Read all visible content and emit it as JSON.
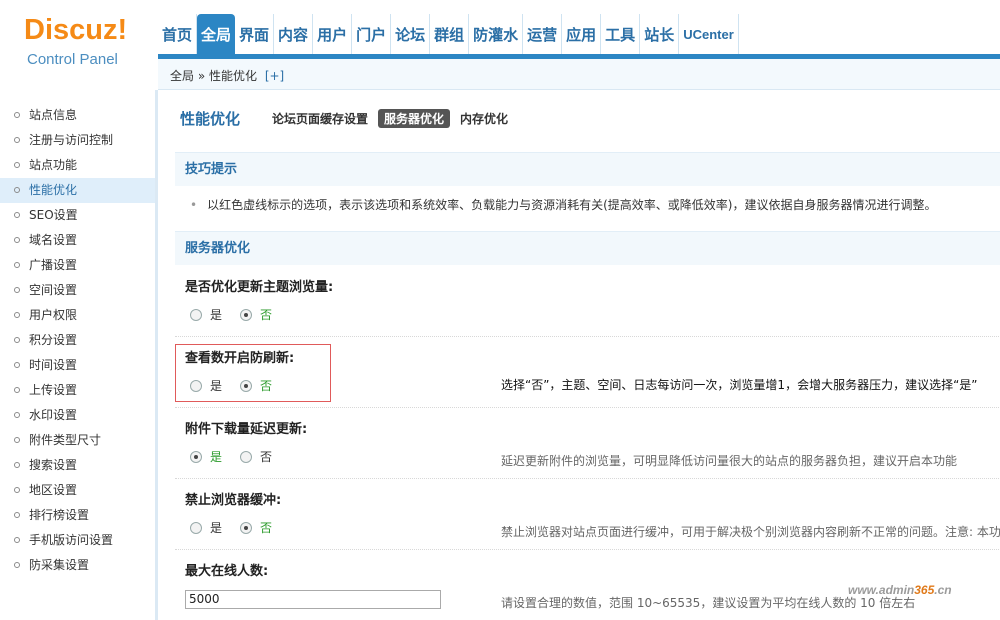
{
  "logo": {
    "main": "Discuz!",
    "sub": "Control Panel"
  },
  "topnav": {
    "tabs": [
      {
        "label": "首页",
        "active": false
      },
      {
        "label": "全局",
        "active": true
      },
      {
        "label": "界面",
        "active": false
      },
      {
        "label": "内容",
        "active": false
      },
      {
        "label": "用户",
        "active": false
      },
      {
        "label": "门户",
        "active": false
      },
      {
        "label": "论坛",
        "active": false
      },
      {
        "label": "群组",
        "active": false
      },
      {
        "label": "防灌水",
        "active": false
      },
      {
        "label": "运营",
        "active": false
      },
      {
        "label": "应用",
        "active": false
      },
      {
        "label": "工具",
        "active": false
      },
      {
        "label": "站长",
        "active": false
      },
      {
        "label": "UCenter",
        "active": false
      }
    ]
  },
  "breadcrumb": {
    "path": "全局 » 性能优化",
    "add": "[+]"
  },
  "sidebar": {
    "items": [
      {
        "label": "站点信息"
      },
      {
        "label": "注册与访问控制"
      },
      {
        "label": "站点功能"
      },
      {
        "label": "性能优化",
        "active": true
      },
      {
        "label": "SEO设置"
      },
      {
        "label": "域名设置"
      },
      {
        "label": "广播设置"
      },
      {
        "label": "空间设置"
      },
      {
        "label": "用户权限"
      },
      {
        "label": "积分设置"
      },
      {
        "label": "时间设置"
      },
      {
        "label": "上传设置"
      },
      {
        "label": "水印设置"
      },
      {
        "label": "附件类型尺寸"
      },
      {
        "label": "搜索设置"
      },
      {
        "label": "地区设置"
      },
      {
        "label": "排行榜设置"
      },
      {
        "label": "手机版访问设置"
      },
      {
        "label": "防采集设置"
      }
    ]
  },
  "page": {
    "title": "性能优化",
    "subtabs": [
      "论坛页面缓存设置",
      "服务器优化",
      "内存优化"
    ]
  },
  "tips": {
    "heading": "技巧提示",
    "text": "以红色虚线标示的选项，表示该选项和系统效率、负载能力与资源消耗有关(提高效率、或降低效率)，建议依据自身服务器情况进行调整。"
  },
  "server_section": {
    "heading": "服务器优化"
  },
  "settings": [
    {
      "label": "是否优化更新主题浏览量:",
      "yes": "是",
      "no": "否",
      "value": "否",
      "desc": ""
    },
    {
      "label": "查看数开启防刷新:",
      "yes": "是",
      "no": "否",
      "value": "否",
      "desc": "选择“否”，主题、空间、日志每访问一次，浏览量增1，会增大服务器压力，建议选择“是”"
    },
    {
      "label": "附件下载量延迟更新:",
      "yes": "是",
      "no": "否",
      "value": "是",
      "desc": "延迟更新附件的浏览量，可明显降低访问量很大的站点的服务器负担，建议开启本功能"
    },
    {
      "label": "禁止浏览器缓冲:",
      "yes": "是",
      "no": "否",
      "value": "否",
      "desc": "禁止浏览器对站点页面进行缓冲，可用于解决极个别浏览器内容刷新不正常的问题。注意: 本功"
    },
    {
      "label": "最大在线人数:",
      "input_value": "5000",
      "desc": "请设置合理的数值，范围 10~65535，建议设置为平均在线人数的 10 倍左右"
    }
  ],
  "watermark": {
    "prefix": "www.",
    "brand": "admin",
    "num": "365",
    "suffix": ".cn"
  }
}
